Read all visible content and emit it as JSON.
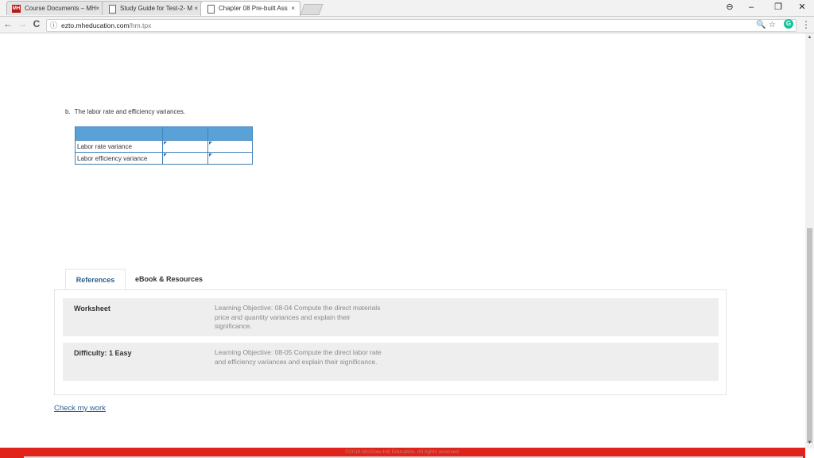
{
  "browser": {
    "tabs": [
      {
        "label": "Course Documents – MH",
        "favicon": "MH",
        "active": false
      },
      {
        "label": "Study Guide for Test-2- M",
        "favicon": "doc-icon",
        "active": false
      },
      {
        "label": "Chapter 08 Pre-built Ass",
        "favicon": "doc-icon",
        "active": true
      }
    ],
    "tab_close": "×",
    "window_controls": {
      "profile": "⊖",
      "minimize": "–",
      "restore": "❐",
      "close": "✕"
    },
    "nav": {
      "back": "←",
      "forward": "→",
      "reload": "C"
    },
    "address": {
      "info": "ⓘ",
      "host": "ezto.mheducation.com",
      "path": "/hm.tpx"
    },
    "omni_icons": {
      "zoom": "🔍",
      "star": "☆"
    },
    "extension": "G",
    "menu": "⋮"
  },
  "question": {
    "letter": "b.",
    "text": "The labor rate and efficiency variances."
  },
  "answer_table": {
    "rows": [
      {
        "label": "Labor rate variance",
        "amount": "",
        "type": ""
      },
      {
        "label": "Labor efficiency variance",
        "amount": "",
        "type": ""
      }
    ]
  },
  "references": {
    "tabs": [
      "References",
      "eBook & Resources"
    ],
    "rows": [
      {
        "title": "Worksheet",
        "desc": "Learning Objective: 08-04 Compute the direct materials price and quantity variances and explain their significance."
      },
      {
        "title": "Difficulty: 1 Easy",
        "desc": "Learning Objective: 08-05 Compute the direct labor rate and efficiency variances and explain their significance."
      }
    ]
  },
  "check_link": "Check my work",
  "footer": "©2018 McGraw-Hill Education. All rights reserved.",
  "colors": {
    "table_header": "#5aa1d8",
    "link": "#2a5d8f",
    "footer": "#e0241b"
  }
}
